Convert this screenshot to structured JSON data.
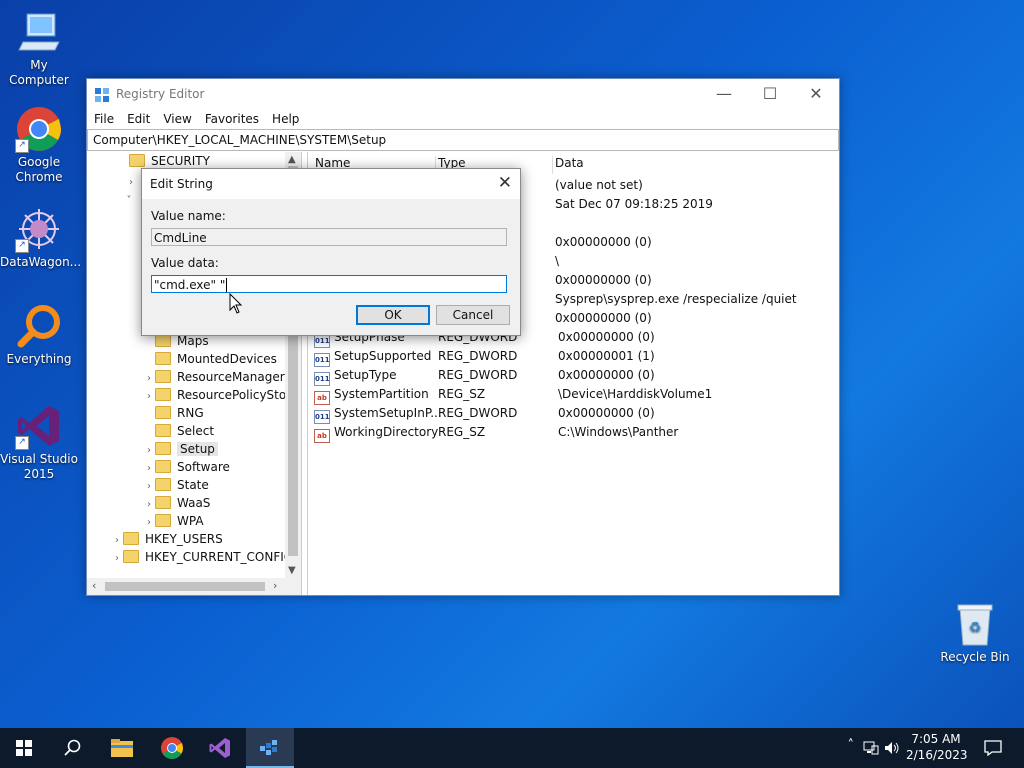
{
  "desktop": {
    "icons": [
      {
        "label": "My Computer"
      },
      {
        "label": "Google\nChrome"
      },
      {
        "label": "DataWagon..."
      },
      {
        "label": "Everything"
      },
      {
        "label": "Visual Studio\n2015"
      },
      {
        "label": "Recycle Bin"
      }
    ]
  },
  "window": {
    "title": "Registry Editor",
    "menu": [
      "File",
      "Edit",
      "View",
      "Favorites",
      "Help"
    ],
    "address": "Computer\\HKEY_LOCAL_MACHINE\\SYSTEM\\Setup",
    "tree": [
      {
        "label": "SECURITY",
        "indent": 0
      },
      {
        "label": "Maps"
      },
      {
        "label": "MountedDevices"
      },
      {
        "label": "ResourceManager"
      },
      {
        "label": "ResourcePolicyStore"
      },
      {
        "label": "RNG"
      },
      {
        "label": "Select"
      },
      {
        "label": "Setup",
        "selected": true
      },
      {
        "label": "Software"
      },
      {
        "label": "State"
      },
      {
        "label": "WaaS"
      },
      {
        "label": "WPA"
      },
      {
        "label": "HKEY_USERS"
      },
      {
        "label": "HKEY_CURRENT_CONFIG"
      }
    ],
    "columns": {
      "name": "Name",
      "type": "Type",
      "data": "Data"
    },
    "values": [
      {
        "name": "",
        "type": "",
        "data": "(value not set)"
      },
      {
        "name": "",
        "type": "",
        "data": "Sat Dec 07 09:18:25 2019"
      },
      {
        "name": "",
        "type": "",
        "data": "0x00000000 (0)"
      },
      {
        "name": "",
        "type": "",
        "data": "\\"
      },
      {
        "name": "",
        "type": "",
        "data": "0x00000000 (0)"
      },
      {
        "name": "",
        "type": "",
        "data": "Sysprep\\sysprep.exe /respecialize /quiet"
      },
      {
        "name": "",
        "type": "",
        "data": "0x00000000 (0)"
      },
      {
        "name": "SetupPhase",
        "type": "REG_DWORD",
        "data": "0x00000000 (0)",
        "icon": "dword"
      },
      {
        "name": "SetupSupported",
        "type": "REG_DWORD",
        "data": "0x00000001 (1)",
        "icon": "dword"
      },
      {
        "name": "SetupType",
        "type": "REG_DWORD",
        "data": "0x00000000 (0)",
        "icon": "dword"
      },
      {
        "name": "SystemPartition",
        "type": "REG_SZ",
        "data": "\\Device\\HarddiskVolume1",
        "icon": "sz"
      },
      {
        "name": "SystemSetupInP...",
        "type": "REG_DWORD",
        "data": "0x00000000 (0)",
        "icon": "dword"
      },
      {
        "name": "WorkingDirectory",
        "type": "REG_SZ",
        "data": "C:\\Windows\\Panther",
        "icon": "sz"
      }
    ]
  },
  "dialog": {
    "title": "Edit String",
    "value_name_label": "Value name:",
    "value_name": "CmdLine",
    "value_data_label": "Value data:",
    "value_data": "\"cmd.exe\" \"",
    "ok_label": "OK",
    "cancel_label": "Cancel"
  },
  "taskbar": {
    "time": "7:05 AM",
    "date": "2/16/2023"
  },
  "colors": {
    "accent": "#0078d7",
    "taskbar": "#0d1a2b"
  }
}
